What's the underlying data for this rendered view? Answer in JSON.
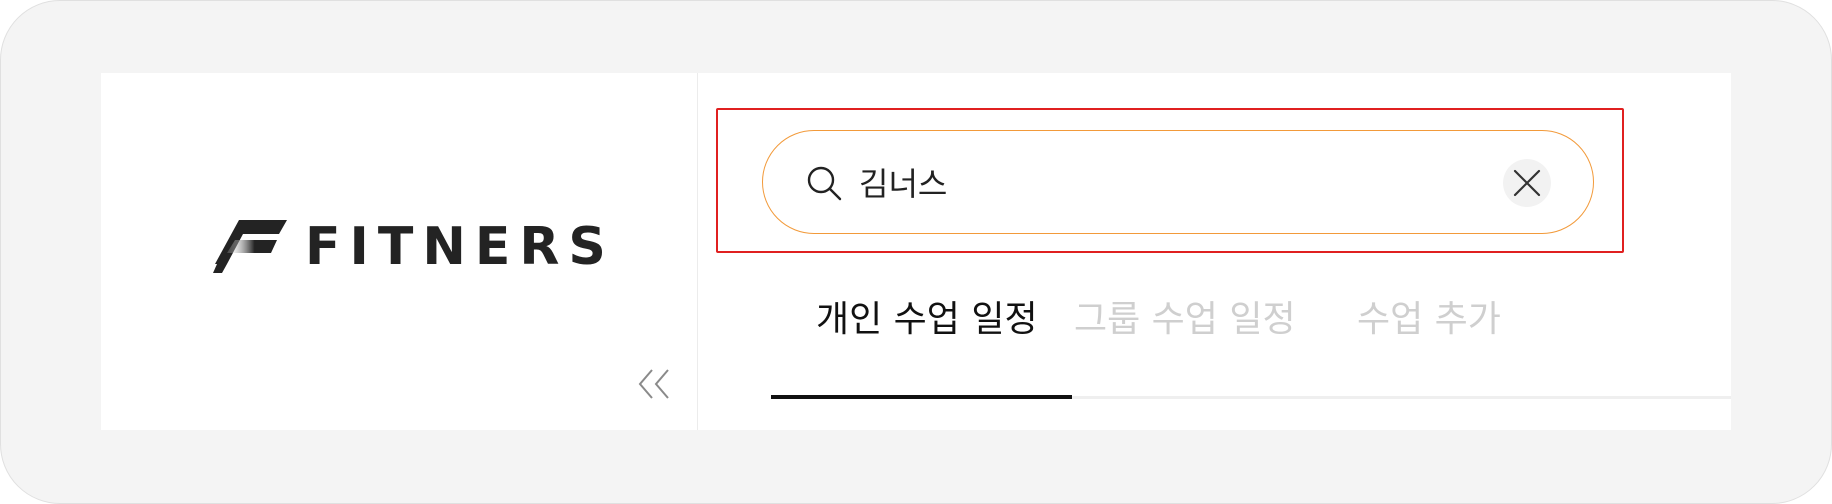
{
  "brand": {
    "name": "FITNERS"
  },
  "search": {
    "value": "김너스"
  },
  "tabs": [
    {
      "label": "개인 수업 일정",
      "active": true
    },
    {
      "label": "그룹 수업 일정",
      "active": false
    },
    {
      "label": "수업 추가",
      "active": false
    }
  ],
  "colors": {
    "highlight_border": "#e02020",
    "search_border": "#f29a3a",
    "tab_active": "#111111",
    "tab_inactive": "#cfcfcf",
    "logo": "#232323"
  },
  "icons": {
    "logo": "fitners-logo-mark",
    "collapse": "double-chevron-left-icon",
    "search": "search-icon",
    "clear": "close-icon"
  }
}
